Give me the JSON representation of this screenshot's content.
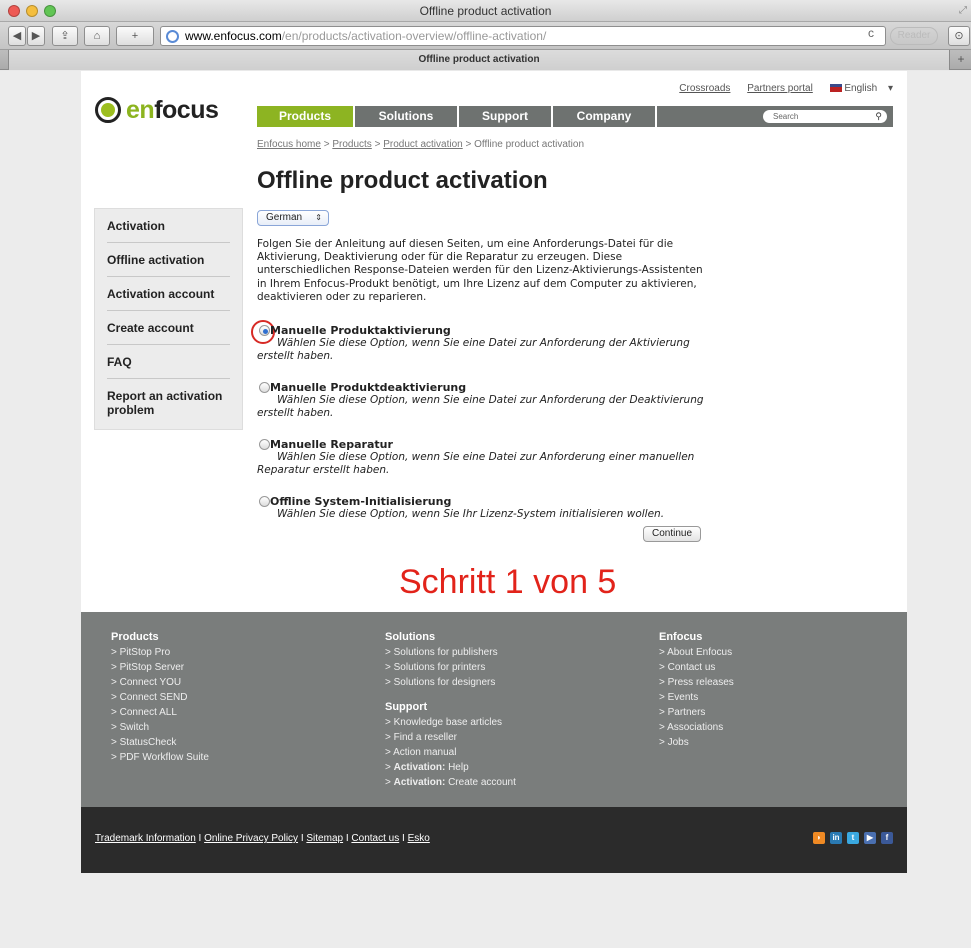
{
  "window": {
    "title": "Offline product activation",
    "tab_title": "Offline product activation"
  },
  "toolbar": {
    "url_host": "www.enfocus.com",
    "url_path": "/en/products/activation-overview/offline-activation/",
    "reader_label": "Reader",
    "back_glyph": "◀",
    "forward_glyph": "▶",
    "share_glyph": "⇪",
    "home_glyph": "⌂",
    "add_glyph": "+",
    "reload_glyph": "c",
    "new_tab_glyph": "+"
  },
  "site": {
    "logo_en": "en",
    "logo_focus": "focus",
    "top_links": [
      "Crossroads",
      "Partners portal"
    ],
    "language": "English",
    "nav": [
      "Products",
      "Solutions",
      "Support",
      "Company"
    ],
    "search_placeholder": "Search",
    "breadcrumb": [
      "Enfocus home",
      "Products",
      "Product activation"
    ],
    "breadcrumb_current": "Offline product activation",
    "page_title": "Offline product activation"
  },
  "sidebar": {
    "items": [
      "Activation",
      "Offline activation",
      "Activation account",
      "Create account",
      "FAQ",
      "Report an activation problem"
    ]
  },
  "content": {
    "language_select": "German",
    "intro": "Folgen Sie der Anleitung auf diesen Seiten, um eine Anforderungs-Datei für die Aktivierung, Deaktivierung oder für die Reparatur zu erzeugen. Diese unterschiedlichen Response-Dateien werden für den Lizenz-Aktivierungs-Assistenten in Ihrem Enfocus-Produkt benötigt, um Ihre Lizenz auf dem Computer zu aktivieren, deaktivieren oder zu reparieren.",
    "options": [
      {
        "label": "Manuelle Produktaktivierung",
        "desc": "Wählen Sie diese Option, wenn Sie eine Datei zur Anforderung der Aktivierung erstellt haben.",
        "checked": true
      },
      {
        "label": "Manuelle Produktdeaktivierung",
        "desc": "Wählen Sie diese Option, wenn Sie eine Datei zur Anforderung der Deaktivierung erstellt haben.",
        "checked": false
      },
      {
        "label": "Manuelle Reparatur",
        "desc": "Wählen Sie diese Option, wenn Sie eine Datei zur Anforderung einer manuellen Reparatur erstellt haben.",
        "checked": false
      },
      {
        "label": "Offline System-Initialisierung",
        "desc": "Wählen Sie diese Option, wenn Sie Ihr Lizenz-System initialisieren wollen.",
        "checked": false
      }
    ],
    "continue_label": "Continue",
    "step_annotation": "Schritt 1 von 5"
  },
  "footer": {
    "products": {
      "heading": "Products",
      "links": [
        "> PitStop Pro",
        "> PitStop Server",
        "> Connect YOU",
        "> Connect SEND",
        "> Connect ALL",
        "> Switch",
        "> StatusCheck",
        "> PDF Workflow Suite"
      ]
    },
    "solutions": {
      "heading": "Solutions",
      "links": [
        "> Solutions for publishers",
        "> Solutions for printers",
        "> Solutions for designers"
      ]
    },
    "support": {
      "heading": "Support",
      "links": [
        "> Knowledge base articles",
        "> Find a reseller",
        "> Action manual"
      ],
      "activation_help_prefix": "> ",
      "activation_help_bold": "Activation:",
      "activation_help_rest": " Help",
      "activation_create_prefix": "> ",
      "activation_create_bold": "Activation:",
      "activation_create_rest": " Create account"
    },
    "enfocus": {
      "heading": "Enfocus",
      "links": [
        "> About Enfocus",
        "> Contact us",
        "> Press releases",
        "> Events",
        "> Partners",
        "> Associations",
        "> Jobs"
      ]
    },
    "legal": [
      "Trademark Information",
      "Online Privacy Policy",
      "Sitemap",
      "Contact us",
      "Esko"
    ],
    "legal_sep": " I ",
    "socials": [
      {
        "name": "rss",
        "glyph": "◗",
        "color": "#f08a24"
      },
      {
        "name": "linkedin",
        "glyph": "in",
        "color": "#2a7ab3"
      },
      {
        "name": "twitter",
        "glyph": "t",
        "color": "#3aa8e0"
      },
      {
        "name": "youtube",
        "glyph": "▶",
        "color": "#4a6fb0"
      },
      {
        "name": "facebook",
        "glyph": "f",
        "color": "#3b5998"
      }
    ]
  },
  "colors": {
    "accent": "#8db422",
    "annotation": "#e2231a",
    "nav_bg": "#6e7270"
  }
}
